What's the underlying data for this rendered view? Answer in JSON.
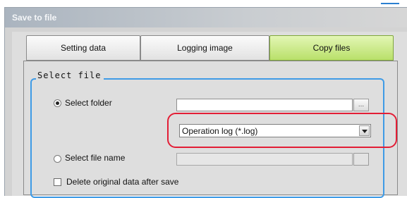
{
  "window": {
    "title": "Save to file"
  },
  "tabs": [
    {
      "label": "Setting data",
      "active": false
    },
    {
      "label": "Logging image",
      "active": false
    },
    {
      "label": "Copy files",
      "active": true
    }
  ],
  "select_file": {
    "group_label": "Select file",
    "select_folder": {
      "label": "Select folder",
      "selected": true,
      "path_value": "",
      "browse_label": "..."
    },
    "file_type": {
      "selected": "Operation log (*.log)"
    },
    "select_file_name": {
      "label": "Select file name",
      "selected": false,
      "path_value": ""
    },
    "delete_after_save": {
      "label": "Delete original data after save",
      "checked": false
    }
  },
  "colors": {
    "accent": "#3f9be6",
    "highlight": "#e31e36",
    "active_tab": "#b9e06a"
  }
}
